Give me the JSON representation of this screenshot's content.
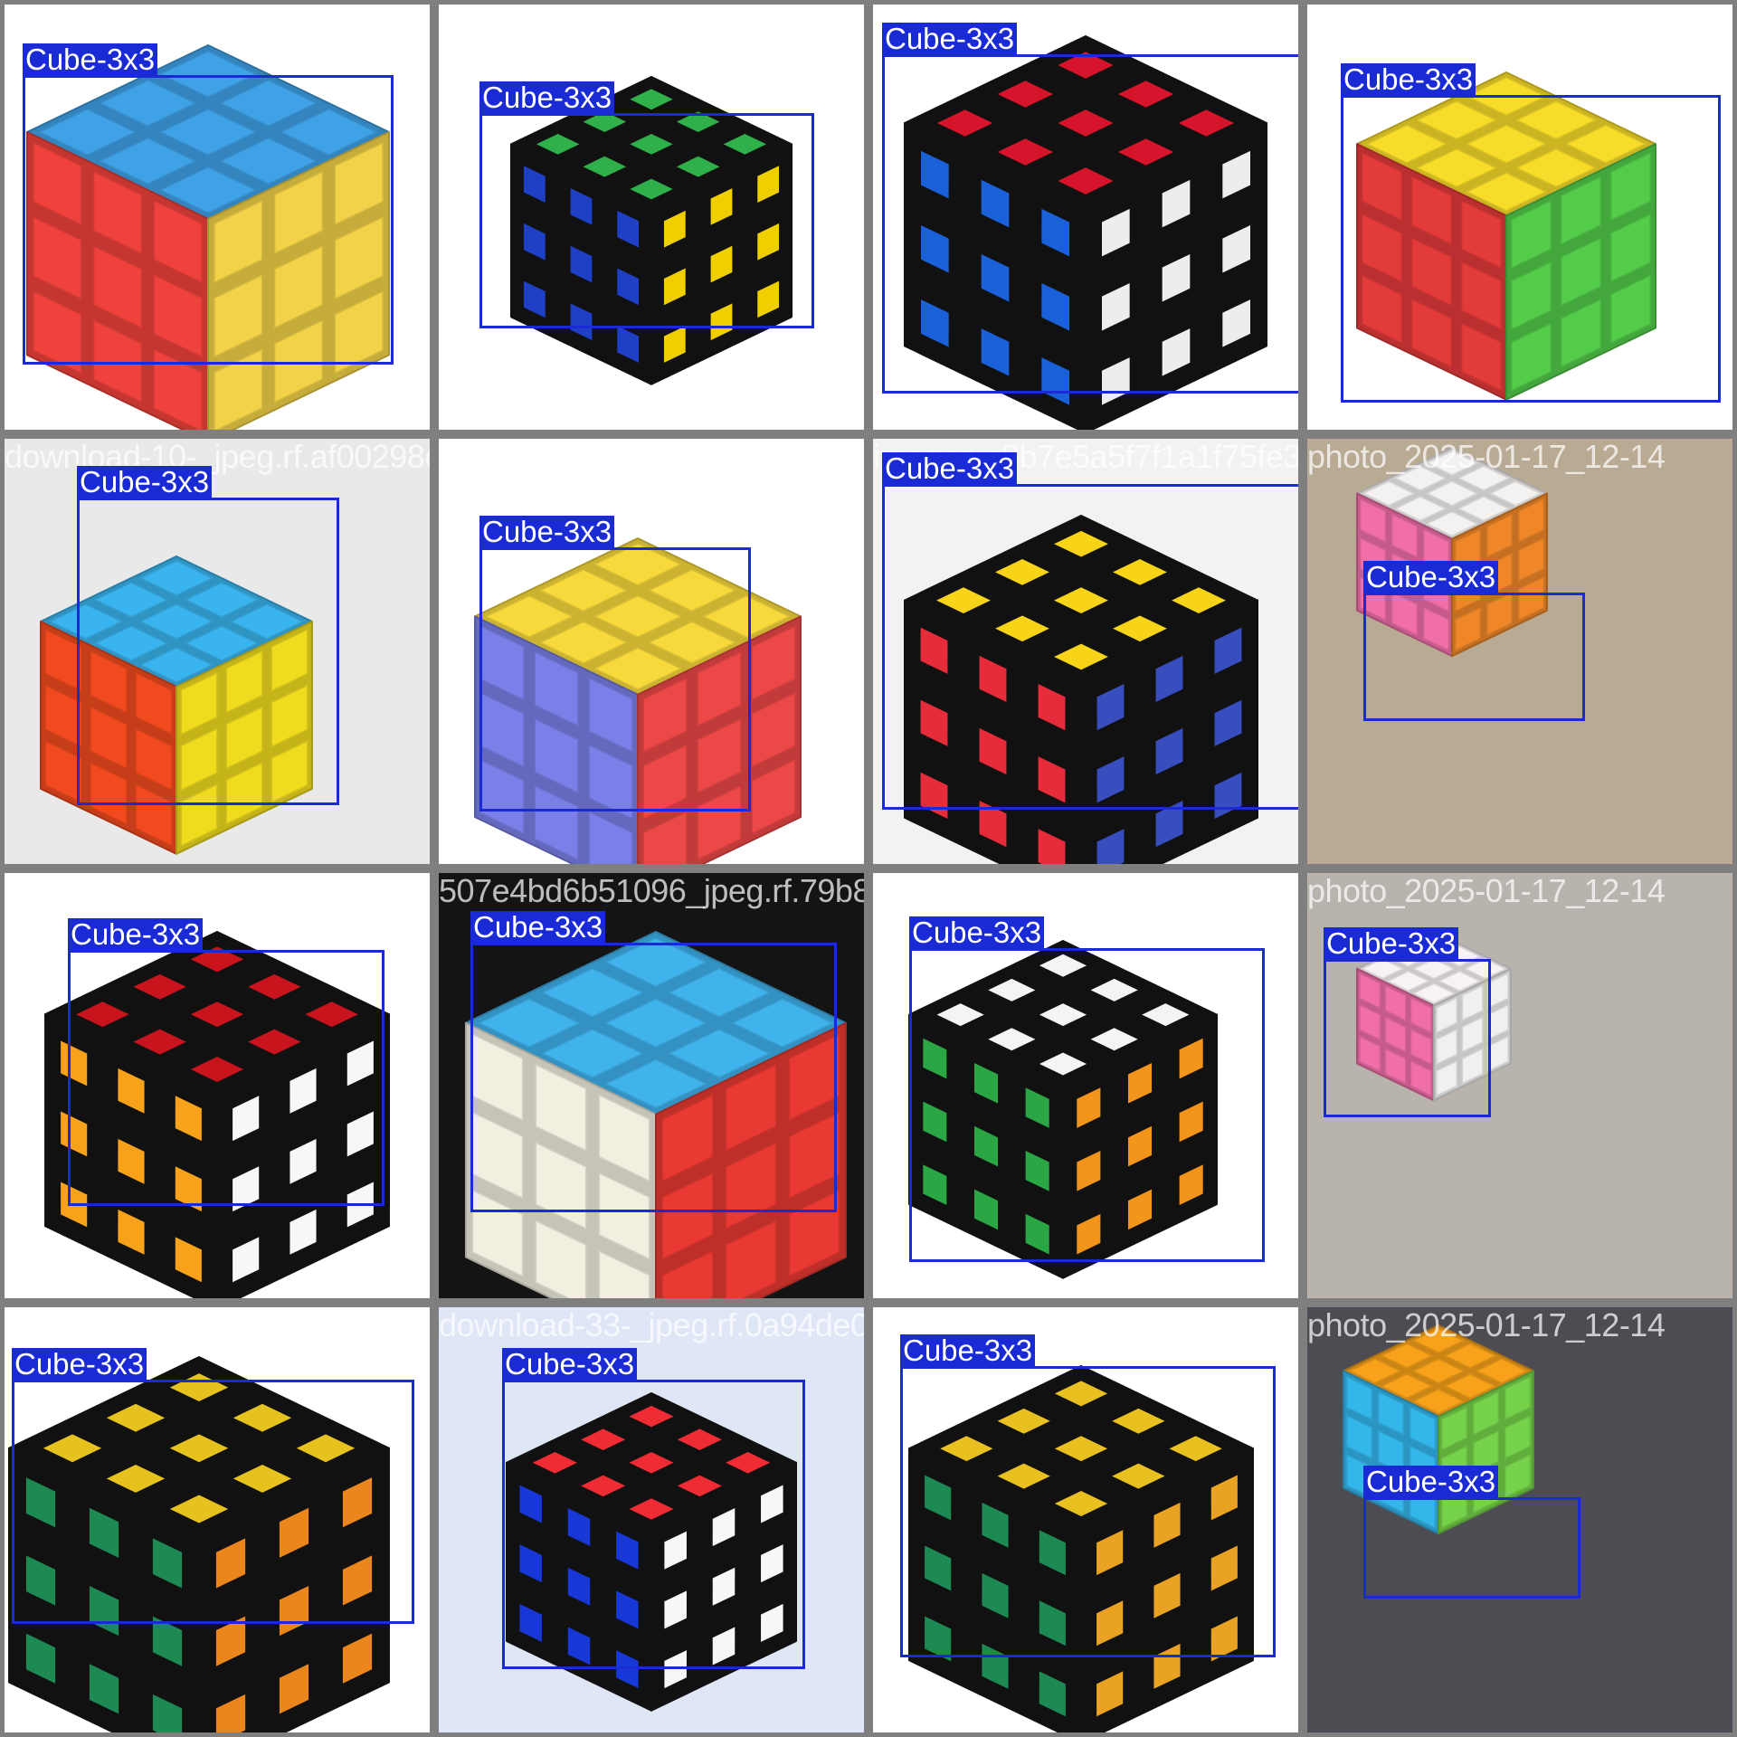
{
  "grid": {
    "tiles": [
      {
        "filename": "download-1-_jpeg.rf.63c4be185758409e3",
        "label": "Cube-3x3",
        "bg": "#ffffff",
        "cube": {
          "top": "#3fa1e6",
          "left": "#f0423c",
          "right": "#f9d84a",
          "sticker_style": "stickerless",
          "stroke": "#e0e0e0"
        }
      },
      {
        "filename": "185758409e3a_jpeg.rf.5e61ca1f51b",
        "label": "Cube-3x3",
        "bg": "#ffffff",
        "cube": {
          "top": "#2fb04a",
          "left": "#1f3fc4",
          "right": "#f7d500",
          "sticker_style": "black",
          "stroke": "#111111"
        }
      },
      {
        "filename": "images-4f1ccebbc9f1ac7e3c",
        "label": "Cube-3x3",
        "bg": "#ffffff",
        "cube": {
          "top": "#d6152d",
          "left": "#1a60d8",
          "right": "#f4f4f4",
          "sticker_style": "black",
          "stroke": "#111111"
        }
      },
      {
        "filename": "images-3-201-_jpeg.rf.4890538",
        "label": "Cube-3x3",
        "bg": "#ffffff",
        "cube": {
          "top": "#f7dc2a",
          "left": "#e33a3a",
          "right": "#56d24c",
          "sticker_style": "stickerless",
          "stroke": "#e0e0e0"
        }
      },
      {
        "filename": "download-10-_jpeg.rf.af00298c82bbea4e6",
        "label": "Cube-3x3",
        "bg": "#e9e9e9",
        "cube": {
          "top": "#3ab4ee",
          "left": "#f04a1e",
          "right": "#f7e320",
          "sticker_style": "stickerless",
          "stroke": "#e0e0e0"
        }
      },
      {
        "filename": "298c82bbea4e67jpeg.rf.0435e6",
        "label": "Cube-3x3",
        "bg": "#ffffff",
        "cube": {
          "top": "#f7d93c",
          "left": "#7a80e8",
          "right": "#f44a4a",
          "sticker_style": "stickerless",
          "stroke": "#e0e0e0"
        }
      },
      {
        "filename": "images-c8b7e5a5f7f1a1f75fe3",
        "label": "Cube-3x3",
        "bg": "#f2f2f2",
        "cube": {
          "top": "#f7d417",
          "left": "#e62b3a",
          "right": "#3a4fc4",
          "sticker_style": "black",
          "stroke": "#111111"
        }
      },
      {
        "filename": "photo_2025-01-17_12-14",
        "label": "Cube-3x3",
        "bg": "#b8aa93",
        "cube": {
          "top": "#f4f1f1",
          "left": "#f06fa8",
          "right": "#f68b2a",
          "sticker_style": "stickerless",
          "stroke": "#d0d0d0"
        }
      },
      {
        "filename": "download-14-_jpeg.rf.30f4b507e4bd6b51096",
        "label": "Cube-3x3",
        "bg": "#ffffff",
        "cube": {
          "top": "#c9141e",
          "left": "#f7a21a",
          "right": "#ffffff",
          "sticker_style": "black",
          "stroke": "#111111"
        }
      },
      {
        "filename": "507e4bd6b51096_jpeg.rf.79b83d",
        "label": "Cube-3x3",
        "bg": "#141414",
        "cube": {
          "top": "#40b2ec",
          "left": "#f2eee0",
          "right": "#ef3b34",
          "sticker_style": "stickerless",
          "stroke": "#d8d8d8"
        }
      },
      {
        "filename": "images-86705-a64_jpeg.rf.3797d04b95c81b0025",
        "label": "Cube-3x3",
        "bg": "#ffffff",
        "cube": {
          "top": "#f4f4f4",
          "left": "#2aa744",
          "right": "#fa9a1c",
          "sticker_style": "black",
          "stroke": "#111111"
        }
      },
      {
        "filename": "photo_2025-01-17_12-14",
        "label": "Cube-3x3",
        "bg": "#b8b3ac",
        "cube": {
          "top": "#f7f2f4",
          "left": "#f06fa8",
          "right": "#f7f7f7",
          "sticker_style": "stickerless",
          "stroke": "#d0d0d0"
        }
      },
      {
        "filename": "download-45-_jpeg.rf.591e2c1b5e0ad6932",
        "label": "Cube-3x3",
        "bg": "#ffffff",
        "cube": {
          "top": "#e6c21e",
          "left": "#1c8a52",
          "right": "#f28a1e",
          "sticker_style": "black",
          "stroke": "#111111"
        }
      },
      {
        "filename": "download-33-_jpeg.rf.0a94de0",
        "label": "Cube-3x3",
        "bg": "#dfe6f6",
        "cube": {
          "top": "#ef2b33",
          "left": "#1737d6",
          "right": "#ffffff",
          "sticker_style": "black",
          "stroke": "#111111"
        }
      },
      {
        "filename": "images-7799-37-_jpeg.rf.8d350c0c45363170",
        "label": "Cube-3x3",
        "bg": "#ffffff",
        "cube": {
          "top": "#e8c020",
          "left": "#1c8a52",
          "right": "#f0a722",
          "sticker_style": "black",
          "stroke": "#111111"
        }
      },
      {
        "filename": "photo_2025-01-17_12-14",
        "label": "Cube-3x3",
        "bg": "#4c4c52",
        "cube": {
          "top": "#f7a21a",
          "left": "#33b6ea",
          "right": "#79d84c",
          "sticker_style": "stickerless",
          "stroke": "#d0d0d0"
        }
      }
    ]
  }
}
